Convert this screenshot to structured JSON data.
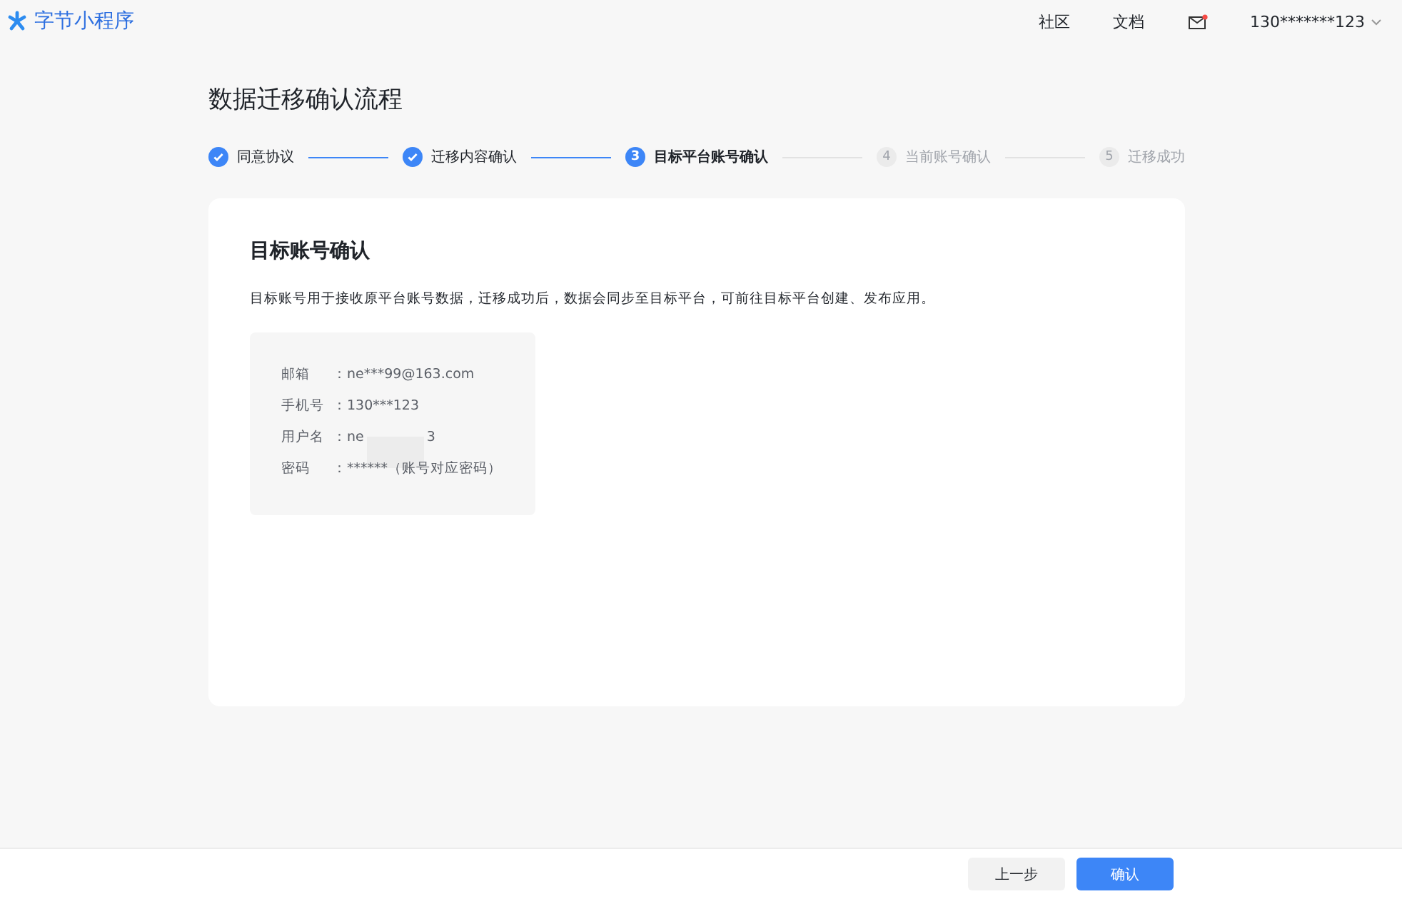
{
  "header": {
    "logo": "字节小程序",
    "nav": [
      "社区",
      "文档"
    ],
    "mail_unread": true,
    "account": "130*******123"
  },
  "page_title": "数据迁移确认流程",
  "steps": [
    {
      "label": "同意协议",
      "done": true,
      "current": false
    },
    {
      "label": "迁移内容确认",
      "done": true,
      "current": false
    },
    {
      "number": "3",
      "label": "目标平台账号确认",
      "done": false,
      "current": true
    },
    {
      "number": "4",
      "label": "当前账号确认",
      "done": false,
      "current": false
    },
    {
      "number": "5",
      "label": "迁移成功",
      "done": false,
      "current": false
    }
  ],
  "card": {
    "title": "目标账号确认",
    "description": "目标账号用于接收原平台账号数据，迁移成功后，数据会同步至目标平台，可前往目标平台创建、发布应用。",
    "fields": [
      {
        "label": "邮箱",
        "colon": "：",
        "value": "ne***99@163.com"
      },
      {
        "label": "手机号",
        "colon": "：",
        "value": "130***123"
      },
      {
        "label": "用户名",
        "colon": "：",
        "value": "ne",
        "value_end": "3",
        "redacted": true
      },
      {
        "label": "密码",
        "colon": "：",
        "value": "******（账号对应密码）"
      }
    ]
  },
  "footer": {
    "buttons": [
      {
        "label": "上一步",
        "kind": "secondary"
      },
      {
        "label": "确认",
        "kind": "primary"
      }
    ]
  }
}
